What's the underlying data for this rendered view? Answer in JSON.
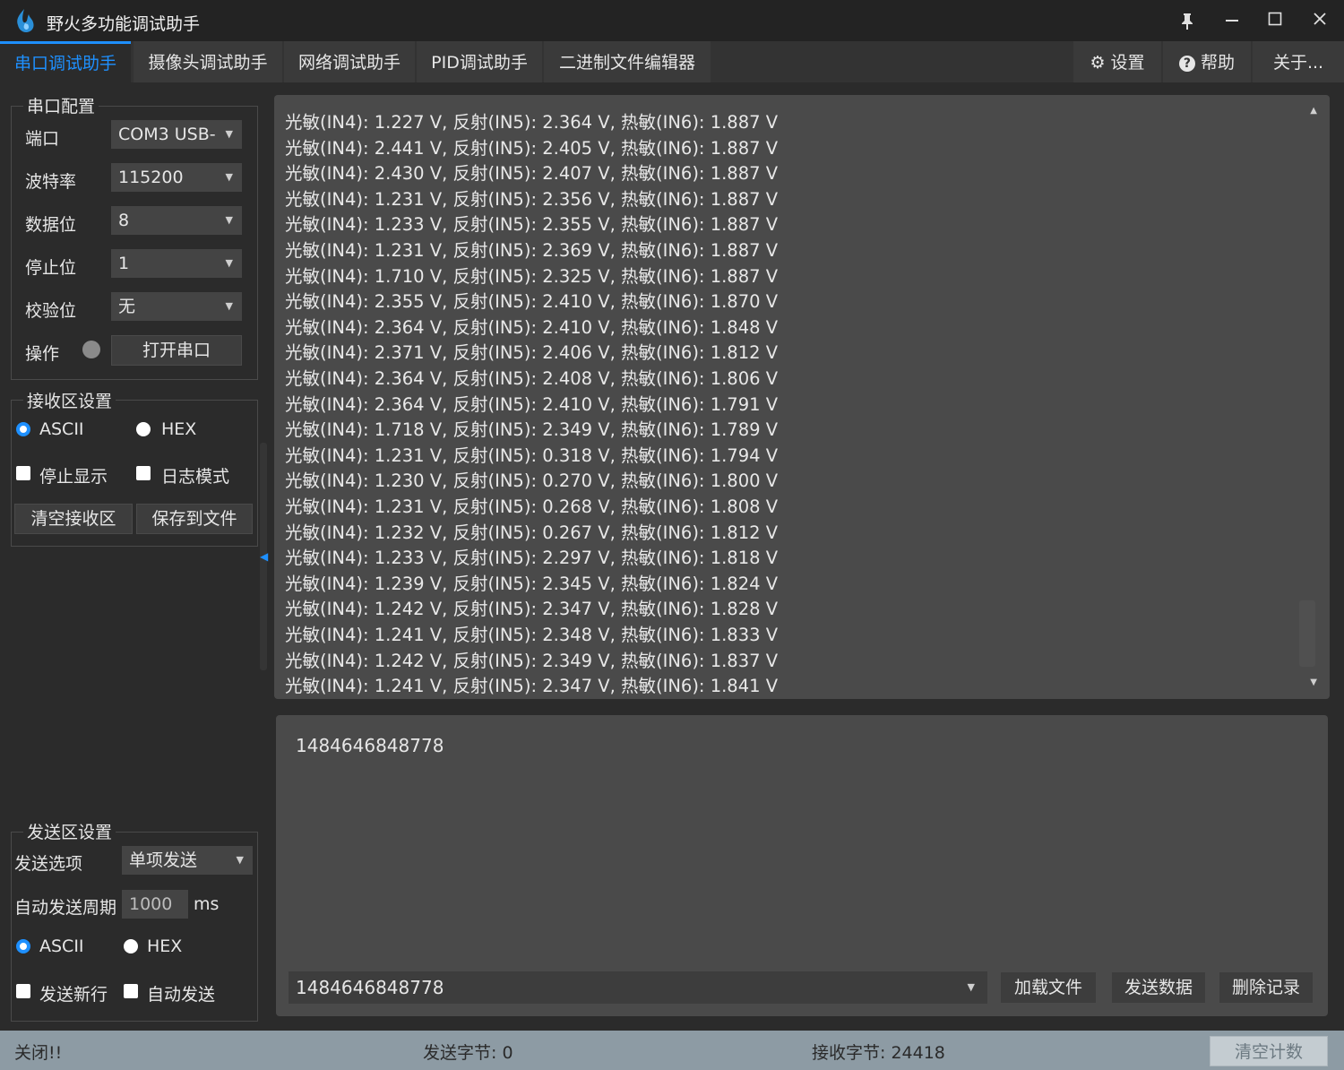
{
  "window": {
    "title": "野火多功能调试助手",
    "controls": [
      "pin-icon",
      "minimize-icon",
      "maximize-icon",
      "close-icon"
    ]
  },
  "tabs": [
    {
      "label": "串口调试助手",
      "active": true
    },
    {
      "label": "摄像头调试助手"
    },
    {
      "label": "网络调试助手"
    },
    {
      "label": "PID调试助手"
    },
    {
      "label": "二进制文件编辑器"
    }
  ],
  "tabs_right": [
    {
      "label": "设置",
      "icon": "gear-icon"
    },
    {
      "label": "帮助",
      "icon": "question-icon"
    },
    {
      "label": "关于..."
    }
  ],
  "serial_config": {
    "legend": "串口配置",
    "port_label": "端口",
    "port_value": "COM3 USB-",
    "baud_label": "波特率",
    "baud_value": "115200",
    "databits_label": "数据位",
    "databits_value": "8",
    "stopbits_label": "停止位",
    "stopbits_value": "1",
    "parity_label": "校验位",
    "parity_value": "无",
    "op_label": "操作",
    "open_button": "打开串口"
  },
  "recv_settings": {
    "legend": "接收区设置",
    "ascii_label": "ASCII",
    "hex_label": "HEX",
    "stop_display_label": "停止显示",
    "log_mode_label": "日志模式",
    "clear_button": "清空接收区",
    "save_button": "保存到文件"
  },
  "send_settings": {
    "legend": "发送区设置",
    "option_label": "发送选项",
    "option_value": "单项发送",
    "period_label": "自动发送周期",
    "period_value": "1000",
    "period_unit": "ms",
    "ascii_label": "ASCII",
    "hex_label": "HEX",
    "newline_label": "发送新行",
    "auto_send_label": "自动发送"
  },
  "receive_lines": [
    "光敏(IN4): 1.227 V, 反射(IN5): 2.364 V, 热敏(IN6): 1.887 V",
    "光敏(IN4): 2.441 V, 反射(IN5): 2.405 V, 热敏(IN6): 1.887 V",
    "光敏(IN4): 2.430 V, 反射(IN5): 2.407 V, 热敏(IN6): 1.887 V",
    "光敏(IN4): 1.231 V, 反射(IN5): 2.356 V, 热敏(IN6): 1.887 V",
    "光敏(IN4): 1.233 V, 反射(IN5): 2.355 V, 热敏(IN6): 1.887 V",
    "光敏(IN4): 1.231 V, 反射(IN5): 2.369 V, 热敏(IN6): 1.887 V",
    "光敏(IN4): 1.710 V, 反射(IN5): 2.325 V, 热敏(IN6): 1.887 V",
    "光敏(IN4): 2.355 V, 反射(IN5): 2.410 V, 热敏(IN6): 1.870 V",
    "光敏(IN4): 2.364 V, 反射(IN5): 2.410 V, 热敏(IN6): 1.848 V",
    "光敏(IN4): 2.371 V, 反射(IN5): 2.406 V, 热敏(IN6): 1.812 V",
    "光敏(IN4): 2.364 V, 反射(IN5): 2.408 V, 热敏(IN6): 1.806 V",
    "光敏(IN4): 2.364 V, 反射(IN5): 2.410 V, 热敏(IN6): 1.791 V",
    "光敏(IN4): 1.718 V, 反射(IN5): 2.349 V, 热敏(IN6): 1.789 V",
    "光敏(IN4): 1.231 V, 反射(IN5): 0.318 V, 热敏(IN6): 1.794 V",
    "光敏(IN4): 1.230 V, 反射(IN5): 0.270 V, 热敏(IN6): 1.800 V",
    "光敏(IN4): 1.231 V, 反射(IN5): 0.268 V, 热敏(IN6): 1.808 V",
    "光敏(IN4): 1.232 V, 反射(IN5): 0.267 V, 热敏(IN6): 1.812 V",
    "光敏(IN4): 1.233 V, 反射(IN5): 2.297 V, 热敏(IN6): 1.818 V",
    "光敏(IN4): 1.239 V, 反射(IN5): 2.345 V, 热敏(IN6): 1.824 V",
    "光敏(IN4): 1.242 V, 反射(IN5): 2.347 V, 热敏(IN6): 1.828 V",
    "光敏(IN4): 1.241 V, 反射(IN5): 2.348 V, 热敏(IN6): 1.833 V",
    "光敏(IN4): 1.242 V, 反射(IN5): 2.349 V, 热敏(IN6): 1.837 V",
    "光敏(IN4): 1.241 V, 反射(IN5): 2.347 V, 热敏(IN6): 1.841 V"
  ],
  "send_area": {
    "text": "1484646848778",
    "history_value": "1484646848778",
    "load_button": "加载文件",
    "send_button": "发送数据",
    "delete_button": "删除记录"
  },
  "status": {
    "state": "关闭!!",
    "sent": "发送字节: 0",
    "received": "接收字节: 24418",
    "clear_button": "清空计数"
  },
  "colors": {
    "accent": "#1e90ff",
    "background": "#2b2b2b",
    "panel": "#4a4a4a",
    "statusbar": "#8d9ba4"
  }
}
